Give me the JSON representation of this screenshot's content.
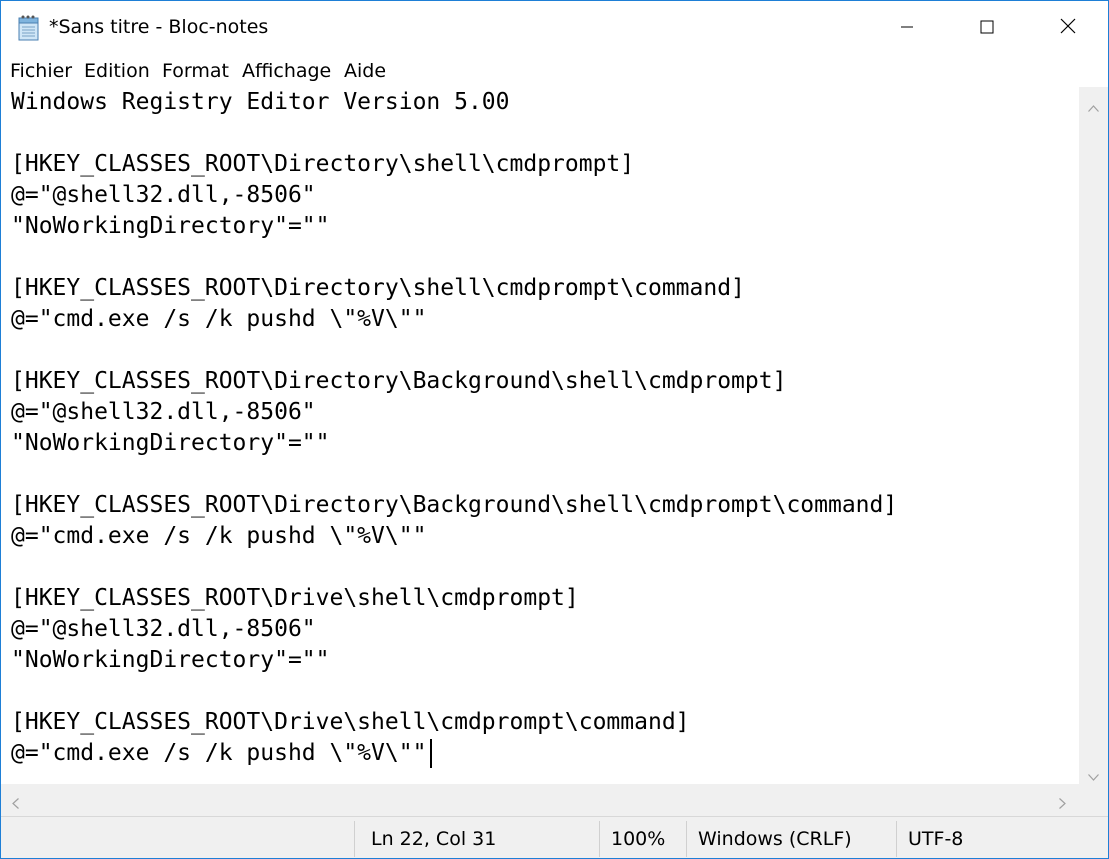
{
  "window": {
    "title": "*Sans titre - Bloc-notes",
    "accent_color": "#1e7fd6",
    "icon": "notepad-icon"
  },
  "window_controls": {
    "minimize_icon": "minimize-icon",
    "maximize_icon": "maximize-icon",
    "close_icon": "close-icon"
  },
  "menu": {
    "items": [
      "Fichier",
      "Edition",
      "Format",
      "Affichage",
      "Aide"
    ]
  },
  "editor": {
    "lines": [
      "Windows Registry Editor Version 5.00",
      "",
      "[HKEY_CLASSES_ROOT\\Directory\\shell\\cmdprompt]",
      "@=\"@shell32.dll,-8506\"",
      "\"NoWorkingDirectory\"=\"\"",
      "",
      "[HKEY_CLASSES_ROOT\\Directory\\shell\\cmdprompt\\command]",
      "@=\"cmd.exe /s /k pushd \\\"%V\\\"\"",
      "",
      "[HKEY_CLASSES_ROOT\\Directory\\Background\\shell\\cmdprompt]",
      "@=\"@shell32.dll,-8506\"",
      "\"NoWorkingDirectory\"=\"\"",
      "",
      "[HKEY_CLASSES_ROOT\\Directory\\Background\\shell\\cmdprompt\\command]",
      "@=\"cmd.exe /s /k pushd \\\"%V\\\"\"",
      "",
      "[HKEY_CLASSES_ROOT\\Drive\\shell\\cmdprompt]",
      "@=\"@shell32.dll,-8506\"",
      "\"NoWorkingDirectory\"=\"\"",
      "",
      "[HKEY_CLASSES_ROOT\\Drive\\shell\\cmdprompt\\command]",
      "@=\"cmd.exe /s /k pushd \\\"%V\\\"\""
    ]
  },
  "scrollbars": {
    "up_icon": "chevron-up-icon",
    "down_icon": "chevron-down-icon",
    "left_icon": "chevron-left-icon",
    "right_icon": "chevron-right-icon"
  },
  "status": {
    "position": "Ln 22, Col 31",
    "zoom": "100%",
    "line_ending": "Windows (CRLF)",
    "encoding": "UTF-8"
  }
}
